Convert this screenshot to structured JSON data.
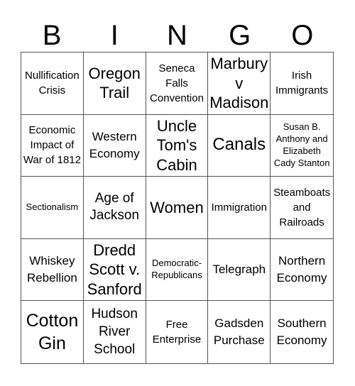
{
  "header": {
    "letters": [
      "B",
      "I",
      "N",
      "G",
      "O"
    ]
  },
  "cells": [
    "Nullification Crisis",
    "Oregon Trail",
    "Seneca Falls Convention",
    "Marbury v Madison",
    "Irish Immigrants",
    "Economic Impact of War of 1812",
    "Western Economy",
    "Uncle Tom's Cabin",
    "Canals",
    "Susan B. Anthony and Elizabeth Cady Stanton",
    "Sectionalism",
    "Age of Jackson",
    "Women",
    "Immigration",
    "Steamboats and Railroads",
    "Whiskey Rebellion",
    "Dredd Scott v. Sanford",
    "Democratic-Republicans",
    "Telegraph",
    "Northern Economy",
    "Cotton Gin",
    "Hudson River School",
    "Free Enterprise",
    "Gadsden Purchase",
    "Southern Economy"
  ]
}
